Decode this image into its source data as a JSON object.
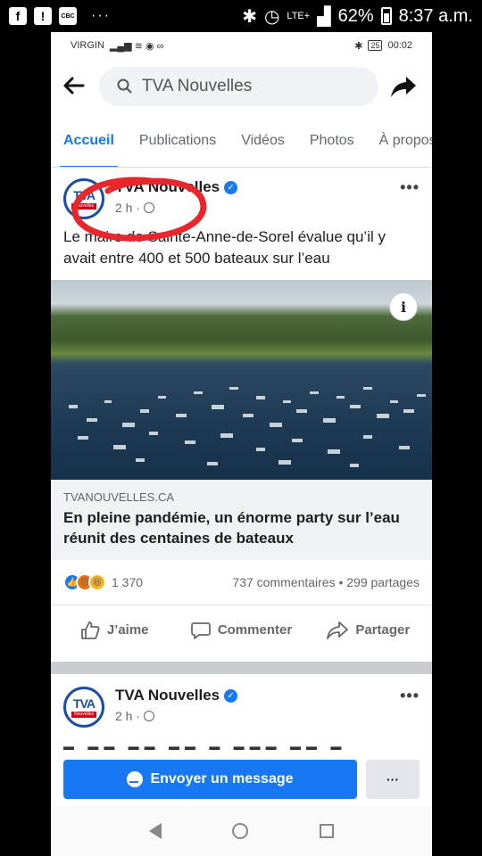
{
  "outer_status": {
    "icons_left": [
      "f",
      "!",
      "CBC"
    ],
    "dots": "···",
    "network": "LTE+",
    "battery": "62%",
    "time": "8:37 a.m."
  },
  "inner_status": {
    "carrier": "VIRGIN",
    "battery_level": "25",
    "time": "00:02"
  },
  "topbar": {
    "search_text": "TVA Nouvelles"
  },
  "tabs": [
    {
      "label": "Accueil",
      "active": true
    },
    {
      "label": "Publications",
      "active": false
    },
    {
      "label": "Vidéos",
      "active": false
    },
    {
      "label": "Photos",
      "active": false
    },
    {
      "label": "À propos",
      "active": false
    }
  ],
  "post1": {
    "page_name": "TVA Nouvelles",
    "time": "2 h",
    "text": "Le maire de Sainte-Anne-de-Sorel évalue qu’il y avait entre 400 et 500 bateaux sur l’eau",
    "link_domain": "TVANOUVELLES.CA",
    "link_headline": "En pleine pandémie, un énorme party sur l’eau réunit des centaines de bateaux",
    "reaction_count": "1 370",
    "comments_shares": "737 commentaires • 299 partages",
    "actions": {
      "like": "J’aime",
      "comment": "Commenter",
      "share": "Partager"
    }
  },
  "post2": {
    "page_name": "TVA Nouvelles",
    "time": "2 h"
  },
  "cta": {
    "message_label": "Envoyer un message",
    "more_label": "···"
  },
  "avatar": {
    "brand": "TVA",
    "sub": "Nouvelles"
  },
  "colors": {
    "accent": "#1877f2",
    "annotation": "#e8262b"
  }
}
